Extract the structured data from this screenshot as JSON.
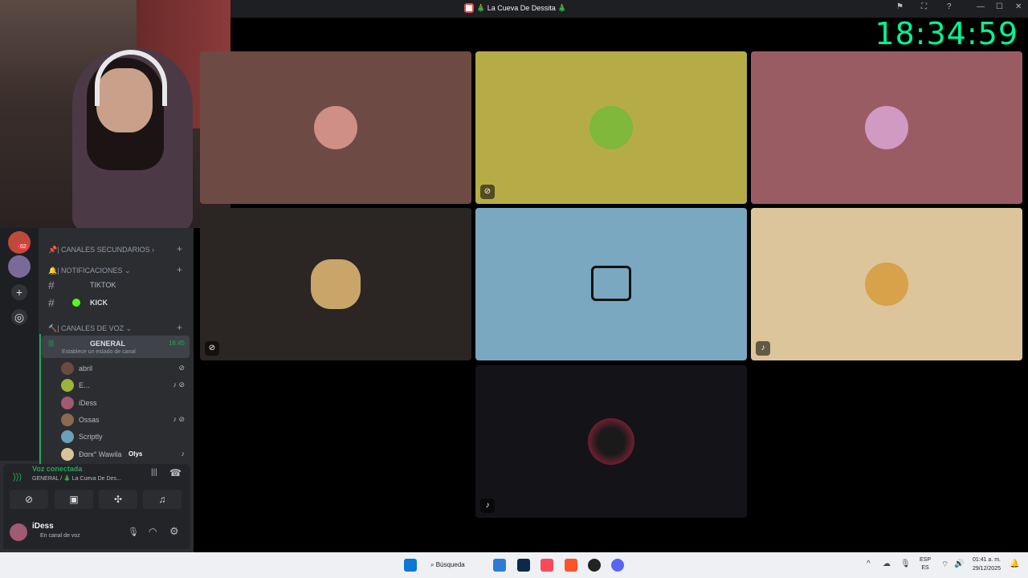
{
  "window": {
    "title": "🎄 La Cueva De Dessita 🎄",
    "minimize": "—",
    "maximize": "☐",
    "close": "✕",
    "inbox_icon": "⚑",
    "screen_icon": "⛶",
    "help_icon": "?"
  },
  "overlay": {
    "clock": "18:34:59"
  },
  "sidebar": {
    "badge": "62",
    "categories": {
      "secundarios": "| CANALES SECUNDARIOS ›",
      "notificaciones": "| NOTIFICACIONES ⌄",
      "voz": "| CANALES DE VOZ ⌄"
    },
    "channels": {
      "tiktok": "TIKTOK",
      "kick": "KICK",
      "general": "GENERAL",
      "general_time": "16:45",
      "general_status": "Establece un estado de canal"
    },
    "members": [
      {
        "name": "abril",
        "color": "#6b4b3e"
      },
      {
        "name": "E...",
        "color": "#9bb43c"
      },
      {
        "name": "iDess",
        "color": "#a05a72"
      },
      {
        "name": "Ossas",
        "color": "#8a6b4f"
      },
      {
        "name": "Scriptly",
        "color": "#6aa0b8"
      },
      {
        "name": "Ðαrк° Wawila",
        "tag": "Olys",
        "color": "#d8c49a"
      }
    ],
    "voice": {
      "status": "Voz conectada",
      "location": "GENERAL / 🎄 La Cueva De Des..."
    },
    "user": {
      "name": "iDess",
      "status": "En canal de voz"
    }
  },
  "tiles": [
    {
      "bg": "#6e4a44",
      "avatar": "#cf8f86"
    },
    {
      "bg": "#b6ac47",
      "avatar": "#7fb83a"
    },
    {
      "bg": "#9a5c63",
      "avatar": "#d19ac2"
    },
    {
      "bg": "#2b2523",
      "avatar": "#c9a56a"
    },
    {
      "bg": "#79a8c0",
      "avatar": "#111111"
    },
    {
      "bg": "#dcc59a",
      "avatar": "#d7a24a"
    },
    {
      "bg": "#141418",
      "avatar": "#8a1b3a"
    }
  ],
  "taskbar": {
    "search": "Búsqueda",
    "lang_top": "ESP",
    "lang_bottom": "ES",
    "time": "01:41 a. m.",
    "date": "29/12/2025"
  }
}
